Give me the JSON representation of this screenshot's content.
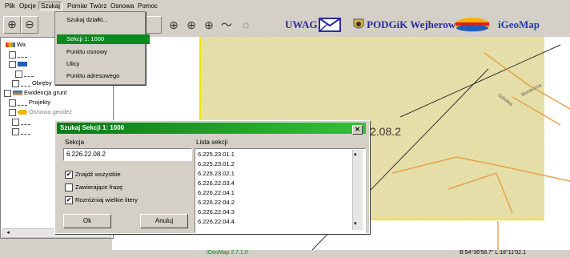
{
  "menubar": [
    "Plik",
    "Opcje",
    "Szukaj",
    "Pomiar",
    "Twórz",
    "Osnowa",
    "Pomoc"
  ],
  "dropdown": [
    "Szukaj działki...",
    "Sekcji 1: 1000",
    "Punktu osnowy",
    "Ulicy",
    "Punktu adresowego"
  ],
  "toolbar": {
    "uwagi": "UWAGI",
    "podgik": "PODGiK Wejherowo",
    "igeomap": "iGeoMap"
  },
  "tree": {
    "rows": [
      "Wa",
      "",
      "",
      "Obręby",
      "Ewidencja grunt",
      "Projekty",
      "Osnowa geodez",
      ""
    ]
  },
  "map": {
    "parcel_label": "2.08.2",
    "street1": "Szkolna",
    "street2": "Słoneczna"
  },
  "dialog": {
    "title": "Szukaj Sekcji 1: 1000",
    "sekcja_label": "Sekcja",
    "sekcja_value": "6.226.22.08.2",
    "lista_label": "Lista sekcji",
    "options": [
      {
        "label": "Znajdź wszystkie",
        "checked": true
      },
      {
        "label": "Zawierające frazę",
        "checked": false
      },
      {
        "label": "Rozróżniaj wielkie litery",
        "checked": true
      }
    ],
    "ok": "Ok",
    "cancel": "Anuluj",
    "list": [
      "6.225.23.01.1",
      "6.225.23.01.2",
      "6.225.23.02.1",
      "6.226.22.03.4",
      "6.226.22.04.1",
      "6.226.22.04.2",
      "6.226.22.04.3",
      "6.226.22.04.4"
    ]
  },
  "statusbar": {
    "version": "iGeoMap 2.7.1.0",
    "coords": "B:54°36'58.7\" L:18°11'02.1"
  },
  "colors": {
    "accent": "#0a8a1f",
    "parcel_border": "#f2e600",
    "road": "#e8a24a"
  }
}
